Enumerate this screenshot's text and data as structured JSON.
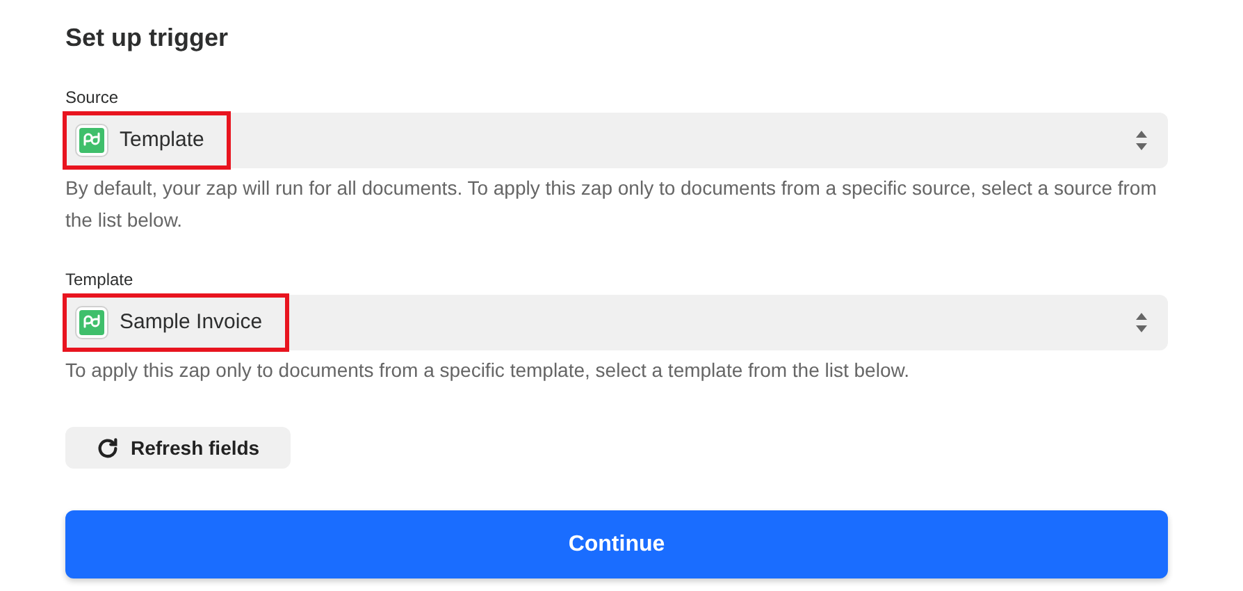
{
  "heading": "Set up trigger",
  "fields": [
    {
      "label": "Source",
      "value": "Template",
      "highlighted": true,
      "help": "By default, your zap will run for all documents. To apply this zap only to documents from a specific source, select a source from the list below."
    },
    {
      "label": "Template",
      "value": "Sample Invoice",
      "highlighted": true,
      "help": "To apply this zap only to documents from a specific template, select a template from the list below."
    }
  ],
  "refresh_button": "Refresh fields",
  "continue_button": "Continue"
}
